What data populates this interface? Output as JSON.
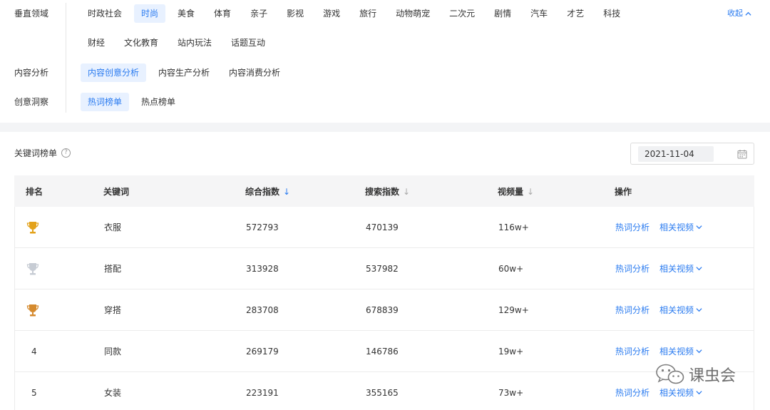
{
  "filters": {
    "vertical": {
      "label": "垂直领域",
      "row1": [
        "时政社会",
        "时尚",
        "美食",
        "体育",
        "亲子",
        "影视",
        "游戏",
        "旅行",
        "动物萌宠",
        "二次元",
        "剧情",
        "汽车",
        "才艺",
        "科技"
      ],
      "row2": [
        "财经",
        "文化教育",
        "站内玩法",
        "话题互动"
      ],
      "active": "时尚",
      "collapse_label": "收起"
    },
    "content_analysis": {
      "label": "内容分析",
      "options": [
        "内容创意分析",
        "内容生产分析",
        "内容消费分析"
      ],
      "active": "内容创意分析"
    },
    "insight": {
      "label": "创意洞察",
      "options": [
        "热词榜单",
        "热点榜单"
      ],
      "active": "热词榜单"
    }
  },
  "list": {
    "title": "关键词榜单",
    "help_icon": "question-circle-icon",
    "date": "2021-11-04",
    "date_icon": "calendar-icon"
  },
  "table": {
    "headers": {
      "rank": "排名",
      "keyword": "关键词",
      "composite": "综合指数",
      "search": "搜索指数",
      "video": "视频量",
      "ops": "操作"
    },
    "sort_arrow": "↓",
    "rows": [
      {
        "rank": "1",
        "rank_icon": "gold-trophy-icon",
        "keyword": "衣服",
        "composite": "572793",
        "search": "470139",
        "video": "116w+",
        "op1": "热词分析",
        "op2": "相关视频"
      },
      {
        "rank": "2",
        "rank_icon": "silver-trophy-icon",
        "keyword": "搭配",
        "composite": "313928",
        "search": "537982",
        "video": "60w+",
        "op1": "热词分析",
        "op2": "相关视频"
      },
      {
        "rank": "3",
        "rank_icon": "bronze-trophy-icon",
        "keyword": "穿搭",
        "composite": "283708",
        "search": "678839",
        "video": "129w+",
        "op1": "热词分析",
        "op2": "相关视频"
      },
      {
        "rank": "4",
        "keyword": "同款",
        "composite": "269179",
        "search": "146786",
        "video": "19w+",
        "op1": "热词分析",
        "op2": "相关视频"
      },
      {
        "rank": "5",
        "keyword": "女装",
        "composite": "223191",
        "search": "355165",
        "video": "73w+",
        "op1": "热词分析",
        "op2": "相关视频"
      }
    ]
  },
  "watermark": {
    "text": "课虫会",
    "icon": "wechat-logo-icon"
  },
  "colors": {
    "accent": "#2a7bf0",
    "active_bg": "#e8f1ff",
    "gold": "#e3a21a",
    "silver": "#c7ccd4",
    "bronze": "#d58a2e"
  }
}
